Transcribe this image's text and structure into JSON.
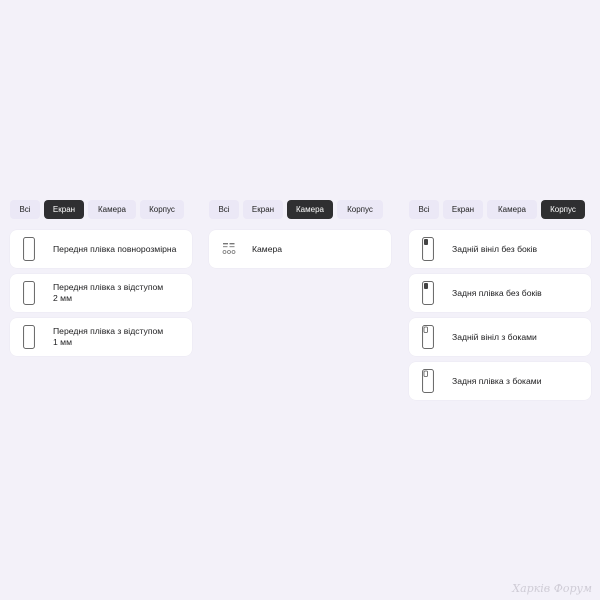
{
  "panels": [
    {
      "tabs": [
        "Всі",
        "Екран",
        "Камера",
        "Корпус"
      ],
      "active_tab": 1,
      "items": [
        {
          "label": "Передня плівка повнорозмірна",
          "icon": "phone-front-icon"
        },
        {
          "label": "Передня плівка з відступом\n2 мм",
          "icon": "phone-front-icon"
        },
        {
          "label": "Передня плівка з відступом\n1 мм",
          "icon": "phone-front-icon"
        }
      ]
    },
    {
      "tabs": [
        "Всі",
        "Екран",
        "Камера",
        "Корпус"
      ],
      "active_tab": 2,
      "items": [
        {
          "label": "Камера",
          "icon": "camera-lens-icon"
        }
      ]
    },
    {
      "tabs": [
        "Всі",
        "Екран",
        "Камера",
        "Корпус"
      ],
      "active_tab": 3,
      "items": [
        {
          "label": "Задній вініл без боків",
          "icon": "phone-back-icon"
        },
        {
          "label": "Задня плівка без боків",
          "icon": "phone-back-icon"
        },
        {
          "label": "Задній вініл з боками",
          "icon": "phone-back-sides-icon"
        },
        {
          "label": "Задня плівка з боками",
          "icon": "phone-back-sides-icon"
        }
      ]
    }
  ],
  "watermark": "Харків Форум"
}
